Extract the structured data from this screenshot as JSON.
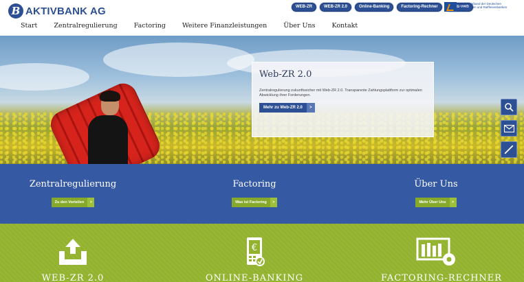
{
  "header": {
    "brand": "AKTIVBANK AG",
    "brand_initial": "B",
    "quicklinks": [
      "WEB-ZR",
      "WEB-ZR 2.0",
      "Online-Banking",
      "Factoring-Rechner",
      "@dis-web"
    ],
    "partner_text": "Bundesverband der Deutschen Volksbanken und Raiffeisenbanken BVR",
    "nav": [
      "Start",
      "Zentralregulierung",
      "Factoring",
      "Weitere Finanzleistungen",
      "Über Uns",
      "Kontakt"
    ]
  },
  "hero": {
    "promo_title": "Web-ZR 2.0",
    "promo_text": "Zentralregulierung zukunftssicher mit Web-ZR 2.0. Transparente Zahlungsplattform zur optimalen Abwicklung ihrer Forderungen.",
    "promo_button": "Mehr zu Web-ZR 2.0",
    "arrow": ">",
    "side_buttons": [
      "search-icon",
      "mail-icon",
      "phone-icon"
    ]
  },
  "teasers": [
    {
      "title": "Zentralregulierung",
      "button": "Zu den Vorteilen"
    },
    {
      "title": "Factoring",
      "button": "Was ist Factoring"
    },
    {
      "title": "Über Uns",
      "button": "Mehr Über Uns"
    }
  ],
  "tiles": [
    {
      "title": "WEB-ZR 2.0",
      "icon": "upload-tray-icon"
    },
    {
      "title": "ONLINE-BANKING",
      "icon": "phone-euro-icon"
    },
    {
      "title": "FACTORING-RECHNER",
      "icon": "chart-gear-icon"
    }
  ],
  "colors": {
    "brand_blue": "#2d4f94",
    "band_blue": "#3659a3",
    "accent_green": "#86a92b",
    "tile_green": "#93b32f"
  }
}
